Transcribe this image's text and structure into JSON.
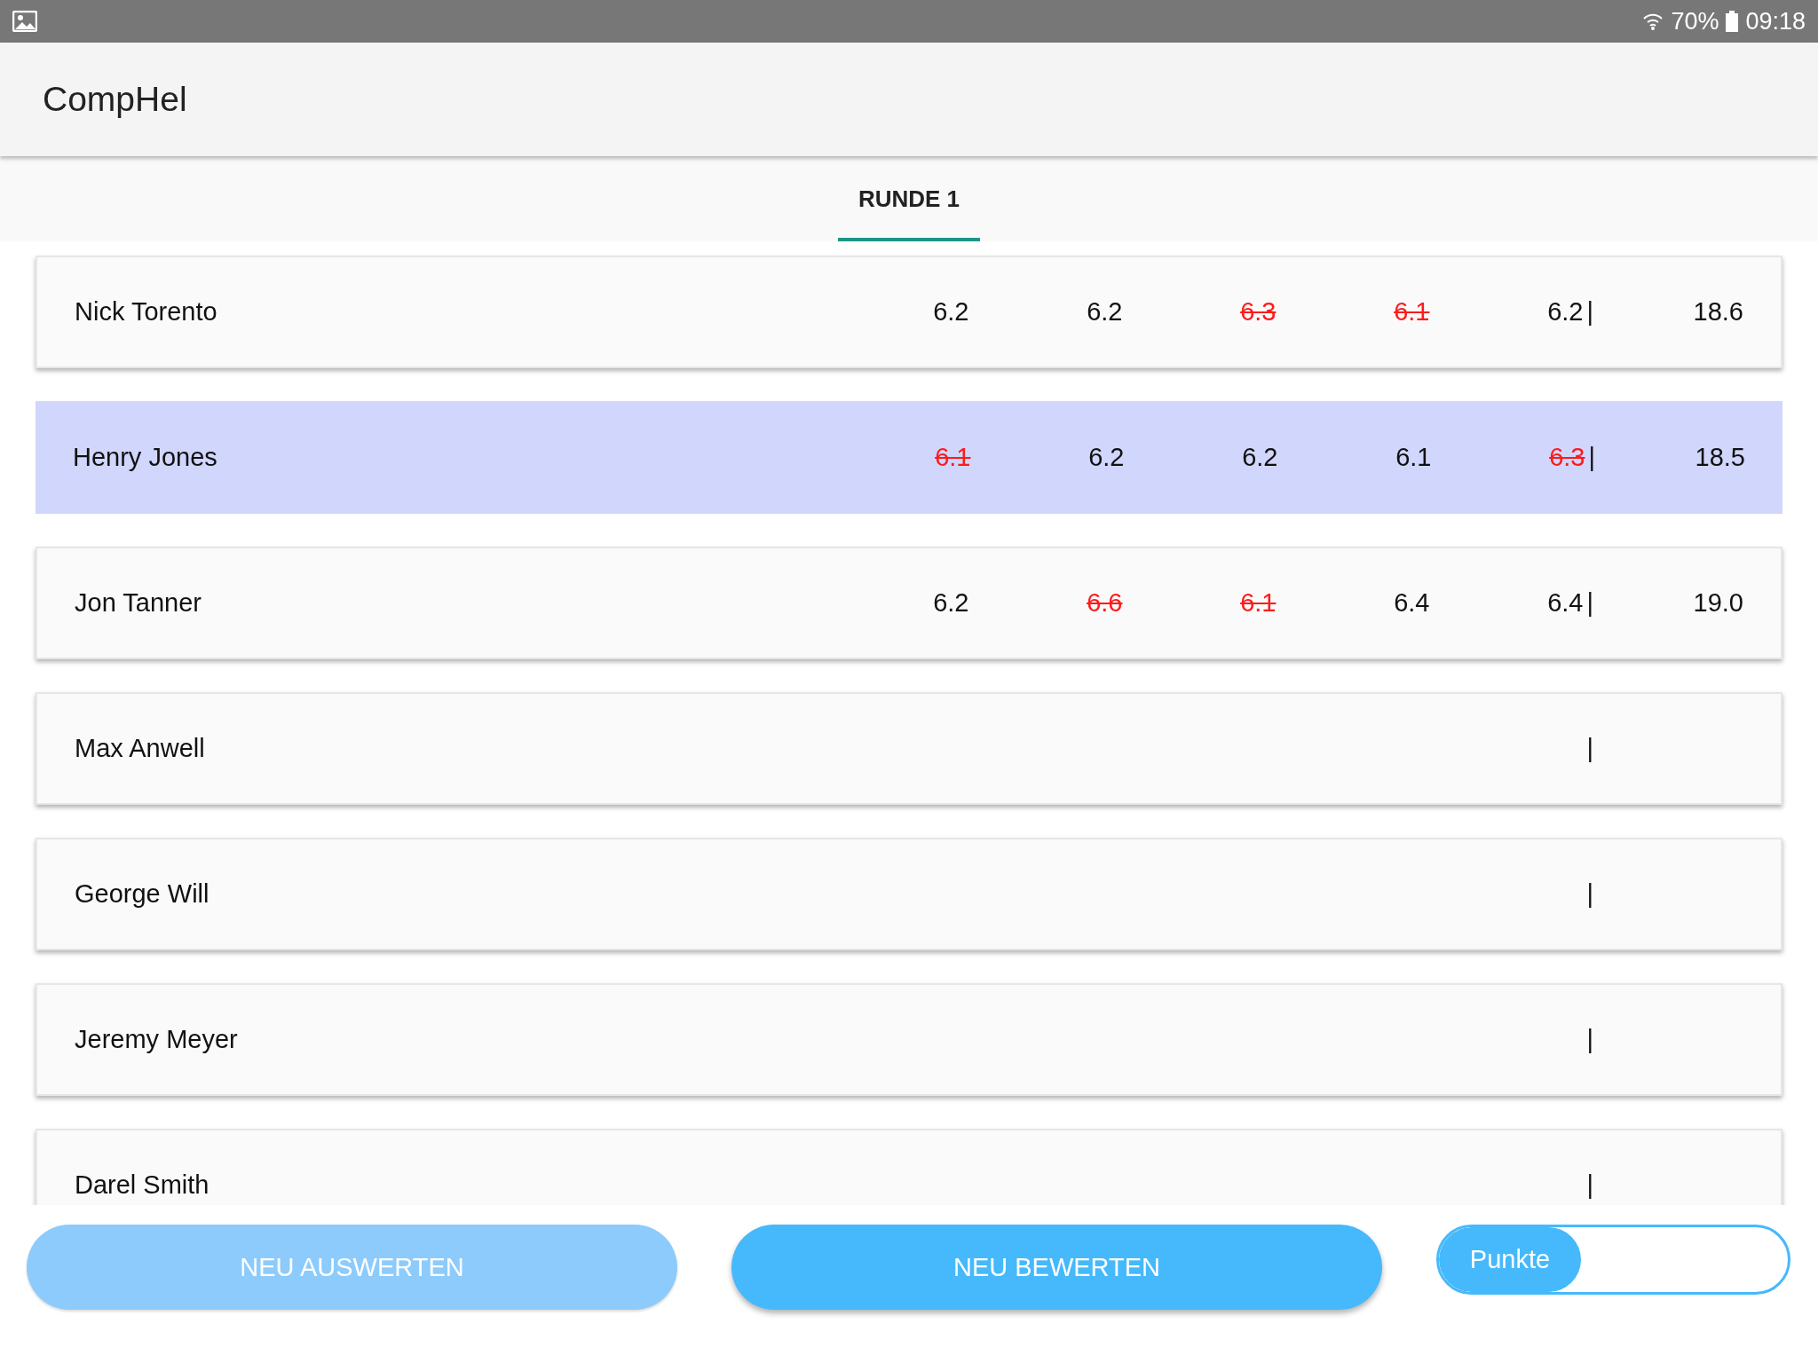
{
  "status_bar": {
    "battery": "70%",
    "time": "09:18"
  },
  "app_bar": {
    "title": "CompHel"
  },
  "tabs": [
    {
      "label": "RUNDE 1",
      "selected": true
    }
  ],
  "rows": [
    {
      "name": "Nick Torento",
      "selected": false,
      "scores": [
        {
          "value": "6.2",
          "struck": false
        },
        {
          "value": "6.2",
          "struck": false
        },
        {
          "value": "6.3",
          "struck": true
        },
        {
          "value": "6.1",
          "struck": true
        },
        {
          "value": "6.2",
          "struck": false
        }
      ],
      "separator": "|",
      "total": "18.6"
    },
    {
      "name": "Henry Jones",
      "selected": true,
      "scores": [
        {
          "value": "6.1",
          "struck": true
        },
        {
          "value": "6.2",
          "struck": false
        },
        {
          "value": "6.2",
          "struck": false
        },
        {
          "value": "6.1",
          "struck": false
        },
        {
          "value": "6.3",
          "struck": true
        }
      ],
      "separator": "|",
      "total": "18.5"
    },
    {
      "name": "Jon Tanner",
      "selected": false,
      "scores": [
        {
          "value": "6.2",
          "struck": false
        },
        {
          "value": "6.6",
          "struck": true
        },
        {
          "value": "6.1",
          "struck": true
        },
        {
          "value": "6.4",
          "struck": false
        },
        {
          "value": "6.4",
          "struck": false
        }
      ],
      "separator": "|",
      "total": "19.0"
    },
    {
      "name": "Max Anwell",
      "selected": false,
      "scores": [],
      "separator": "|"
    },
    {
      "name": "George Will",
      "selected": false,
      "scores": [],
      "separator": "|"
    },
    {
      "name": "Jeremy Meyer",
      "selected": false,
      "scores": [],
      "separator": "|"
    },
    {
      "name": "Darel Smith",
      "selected": false,
      "scores": [],
      "separator": "|"
    }
  ],
  "buttons": [
    {
      "label": "NEU AUSWERTEN",
      "disabled": true
    },
    {
      "label": "NEU BEWERTEN",
      "disabled": false
    }
  ],
  "toggle": {
    "label": "Punkte",
    "on": false
  }
}
